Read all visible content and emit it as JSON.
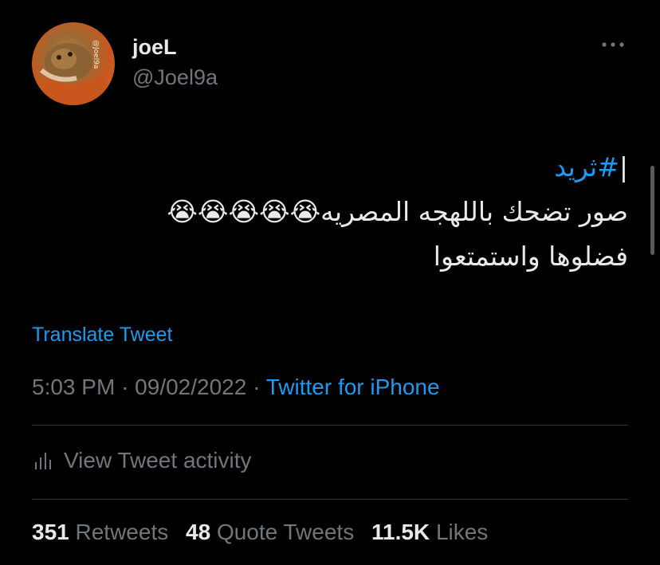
{
  "author": {
    "display_name": "joeL",
    "handle": "@Joel9a",
    "avatar_watermark": "@Joel9a",
    "avatar_icon": "cat-photo-avatar"
  },
  "more_icon": "more-horizontal-icon",
  "tweet": {
    "lines": [
      {
        "hashtag": "#ثريد",
        "cursor": "|"
      },
      {
        "text": "صور تضحك باللهجه المصريه😭😭😭😭😭"
      },
      {
        "text": "فضلوها واستمتعوا"
      }
    ]
  },
  "translate_label": "Translate Tweet",
  "meta": {
    "time": "5:03 PM",
    "separator": "·",
    "date": "09/02/2022",
    "source": "Twitter for iPhone"
  },
  "activity": {
    "icon": "bar-chart-icon",
    "label": "View Tweet activity"
  },
  "stats": [
    {
      "count": "351",
      "label": "Retweets"
    },
    {
      "count": "48",
      "label": "Quote Tweets"
    },
    {
      "count": "11.5K",
      "label": "Likes"
    }
  ],
  "colors": {
    "background": "#000000",
    "text_primary": "#e7e9ea",
    "text_secondary": "#71767b",
    "accent": "#1d9bf0",
    "divider": "#2f3336"
  }
}
